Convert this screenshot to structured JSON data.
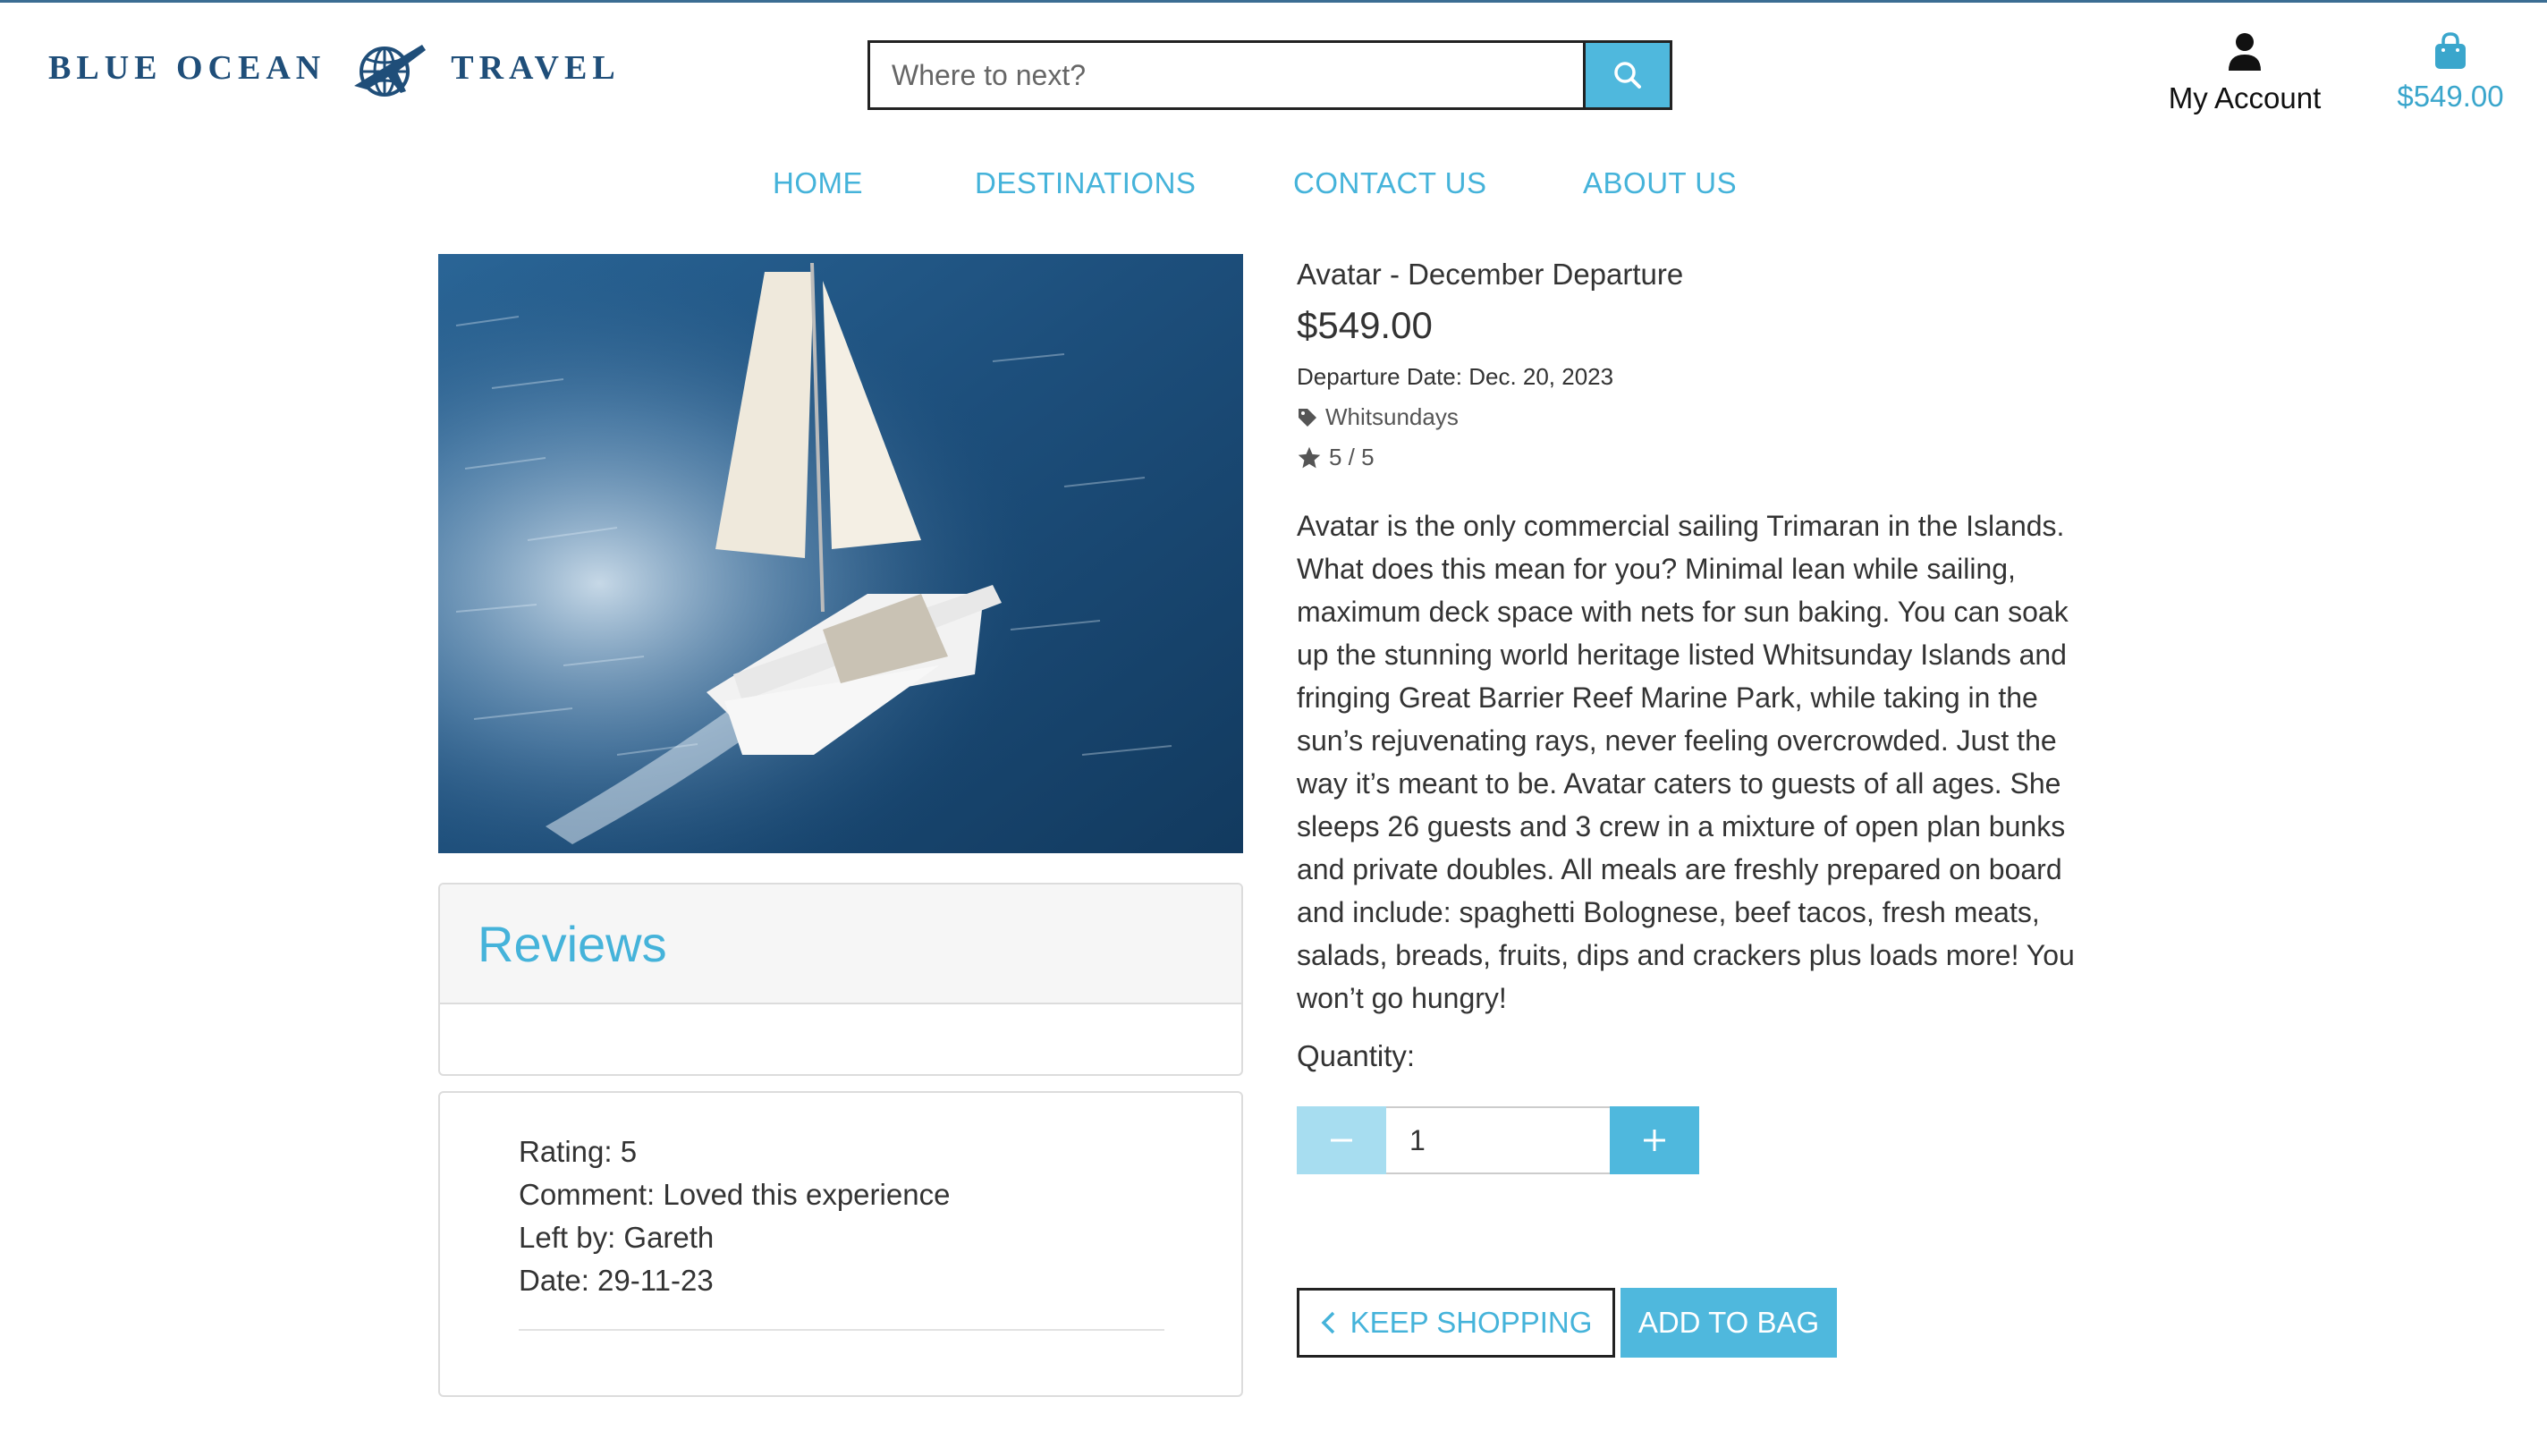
{
  "brand": {
    "word1": "BLUE OCEAN",
    "word2": "TRAVEL",
    "color": "#1f4e79"
  },
  "search": {
    "placeholder": "Where to next?",
    "value": ""
  },
  "header": {
    "account_label": "My Account",
    "bag_total": "$549.00"
  },
  "nav": {
    "items": [
      "HOME",
      "DESTINATIONS",
      "CONTACT US",
      "ABOUT US"
    ]
  },
  "product": {
    "title": "Avatar - December Departure",
    "price": "$549.00",
    "departure": "Departure Date: Dec. 20, 2023",
    "tag": "Whitsundays",
    "rating": "5 / 5",
    "description": "Avatar is the only commercial sailing Trimaran in the Islands. What does this mean for you? Minimal lean while sailing, maximum deck space with nets for sun baking. You can soak up the stunning world heritage listed Whitsunday Islands and fringing Great Barrier Reef Marine Park, while taking in the sun’s rejuvenating rays, never feeling overcrowded. Just the way it’s meant to be. Avatar caters to guests of all ages. She sleeps 26 guests and 3 crew in a mixture of open plan bunks and private doubles. All meals are freshly prepared on board and include: spaghetti Bolognese, beef tacos, fresh meats, salads, breads, fruits, dips and crackers plus loads more! You won’t go hungry!"
  },
  "quantity": {
    "label": "Quantity:",
    "value": "1"
  },
  "buttons": {
    "keep_shopping": "KEEP SHOPPING",
    "add_to_bag": "ADD TO BAG"
  },
  "reviews": {
    "title": "Reviews",
    "items": [
      {
        "rating": "Rating: 5",
        "comment": "Comment: Loved this experience",
        "author": "Left by: Gareth",
        "date": "Date: 29-11-23"
      }
    ]
  },
  "colors": {
    "accent": "#4fb8dd",
    "accent_light": "#a7ddf0",
    "link": "#45b3da",
    "text": "#333333"
  },
  "icons": [
    "globe-plane-logo-icon",
    "search-icon",
    "user-icon",
    "shopping-bag-icon",
    "tag-icon",
    "star-icon",
    "minus-icon",
    "plus-icon",
    "chevron-left-icon"
  ]
}
